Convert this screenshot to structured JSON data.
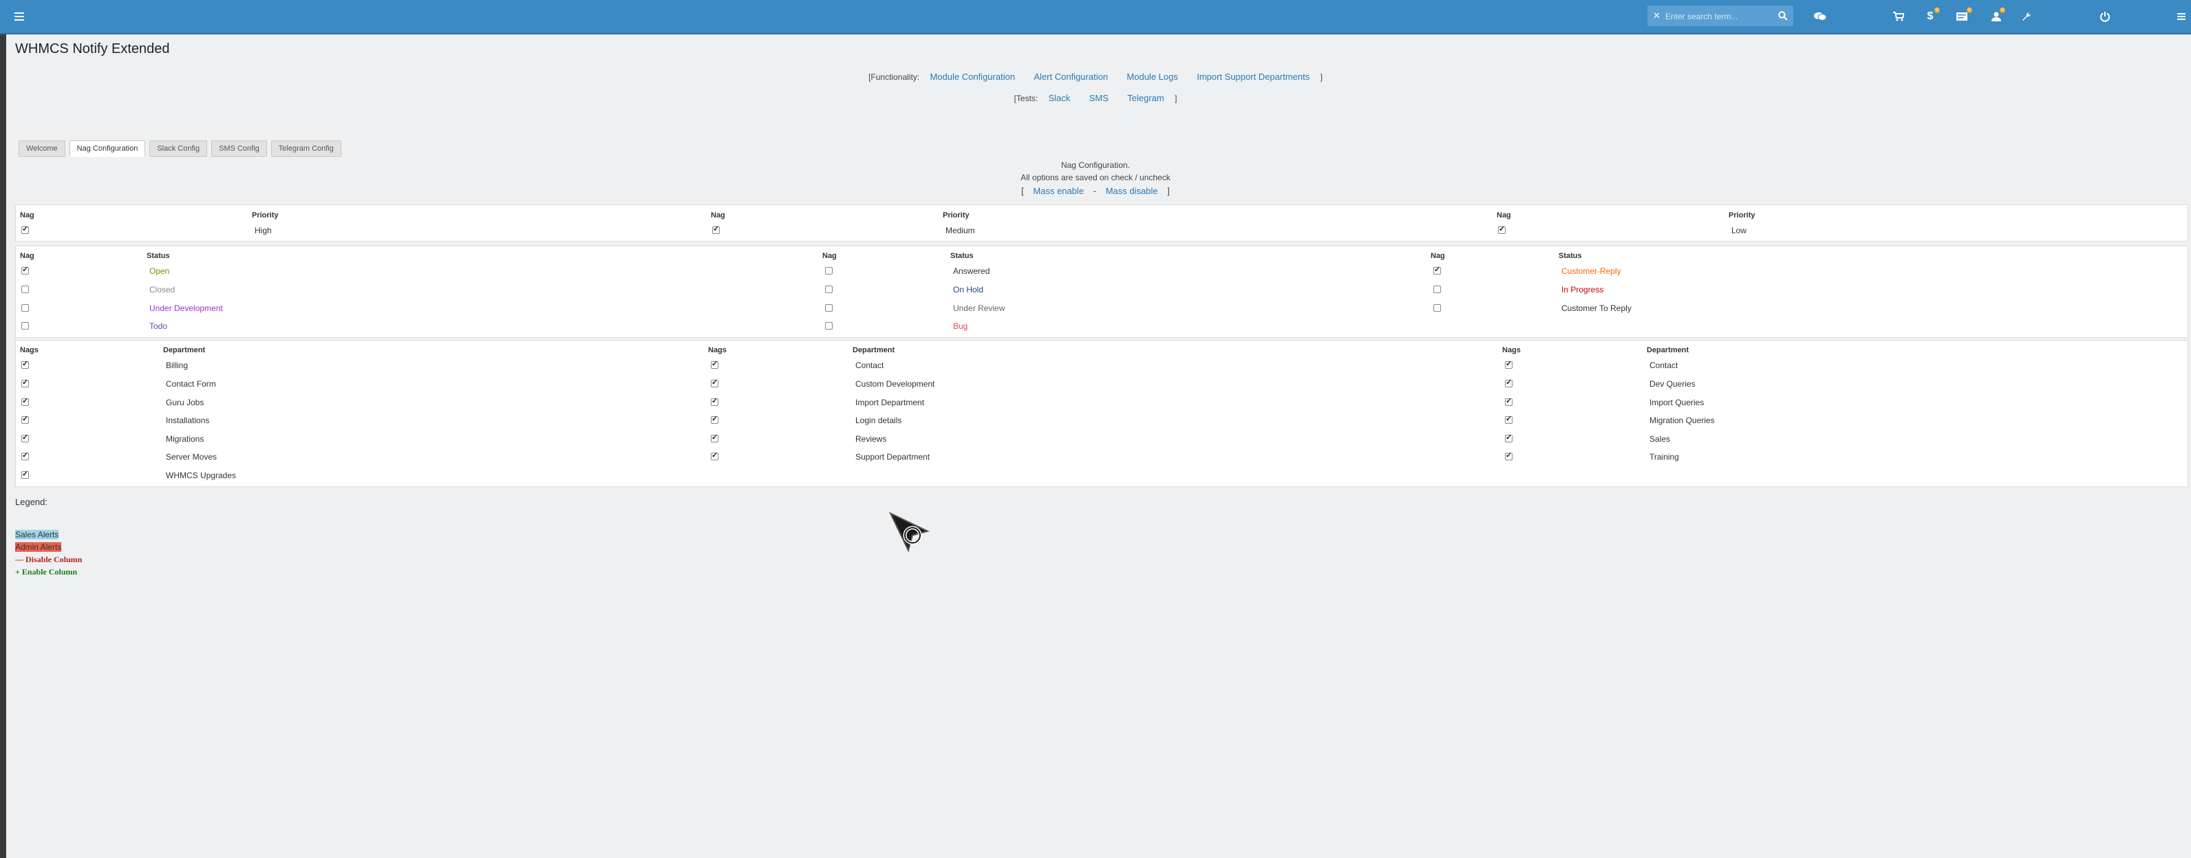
{
  "topbar": {
    "search_placeholder": "Enter search term...",
    "badges": [
      "0",
      "0",
      "0"
    ]
  },
  "page_title": "WHMCS Notify Extended",
  "functionality": {
    "prefix": "[Functionality:",
    "links": [
      "Module Configuration",
      "Alert Configuration",
      "Module Logs",
      "Import Support Departments"
    ],
    "suffix": "]"
  },
  "tests": {
    "prefix": "[Tests:",
    "links": [
      "Slack",
      "SMS",
      "Telegram"
    ],
    "suffix": "]"
  },
  "tabs": [
    "Welcome",
    "Nag Configuration",
    "Slack Config",
    "SMS Config",
    "Telegram Config"
  ],
  "active_tab": 1,
  "notice": {
    "line1": "Nag Configuration.",
    "line2": "All options are saved on check / uncheck"
  },
  "mass": {
    "open": "[",
    "enable": "Mass enable",
    "sep": "-",
    "disable": "Mass disable",
    "close": "]"
  },
  "priority_table": {
    "nag_header": "Nag",
    "priority_header": "Priority",
    "rows": [
      {
        "checked": true,
        "label": "High"
      },
      {
        "checked": true,
        "label": "Medium"
      },
      {
        "checked": true,
        "label": "Low"
      }
    ]
  },
  "status_table": {
    "nag_header": "Nag",
    "status_header": "Status",
    "columns": [
      [
        {
          "checked": true,
          "label": "Open",
          "color": "#779500"
        },
        {
          "checked": false,
          "label": "Closed",
          "color": "#888888"
        },
        {
          "checked": false,
          "label": "Under Development",
          "color": "#9933cc"
        },
        {
          "checked": false,
          "label": "Todo",
          "color": "#5b4ea5"
        }
      ],
      [
        {
          "checked": false,
          "label": "Answered",
          "color": "#333333"
        },
        {
          "checked": false,
          "label": "On Hold",
          "color": "#224488"
        },
        {
          "checked": false,
          "label": "Under Review",
          "color": "#666666"
        },
        {
          "checked": false,
          "label": "Bug",
          "color": "#e84a5f"
        }
      ],
      [
        {
          "checked": true,
          "label": "Customer-Reply",
          "color": "#ff6600"
        },
        {
          "checked": false,
          "label": "In Progress",
          "color": "#cc0000"
        },
        {
          "checked": false,
          "label": "Customer To Reply",
          "color": "#333333"
        }
      ]
    ]
  },
  "department_table": {
    "nags_header": "Nags",
    "department_header": "Department",
    "columns": [
      [
        "Billing",
        "Contact Form",
        "Guru Jobs",
        "Installations",
        "Migrations",
        "Server Moves",
        "WHMCS Upgrades"
      ],
      [
        "Contact",
        "Custom Development",
        "Import Department",
        "Login details",
        "Reviews",
        "Support Department"
      ],
      [
        "Contact",
        "Dev Queries",
        "Import Queries",
        "Migration Queries",
        "Sales",
        "Training"
      ]
    ]
  },
  "legend": {
    "title": "Legend:",
    "items": [
      {
        "label": "Sales Alerts",
        "bg": "#9fd5e8",
        "color": "#333333"
      },
      {
        "label": "Admin Alerts",
        "bg": "#e8624f",
        "color": "#333333"
      },
      {
        "label": "Disable Column",
        "icon": "—",
        "color": "#b22222"
      },
      {
        "label": "Enable Column",
        "icon": "+",
        "color": "#1e7d1e"
      }
    ]
  }
}
